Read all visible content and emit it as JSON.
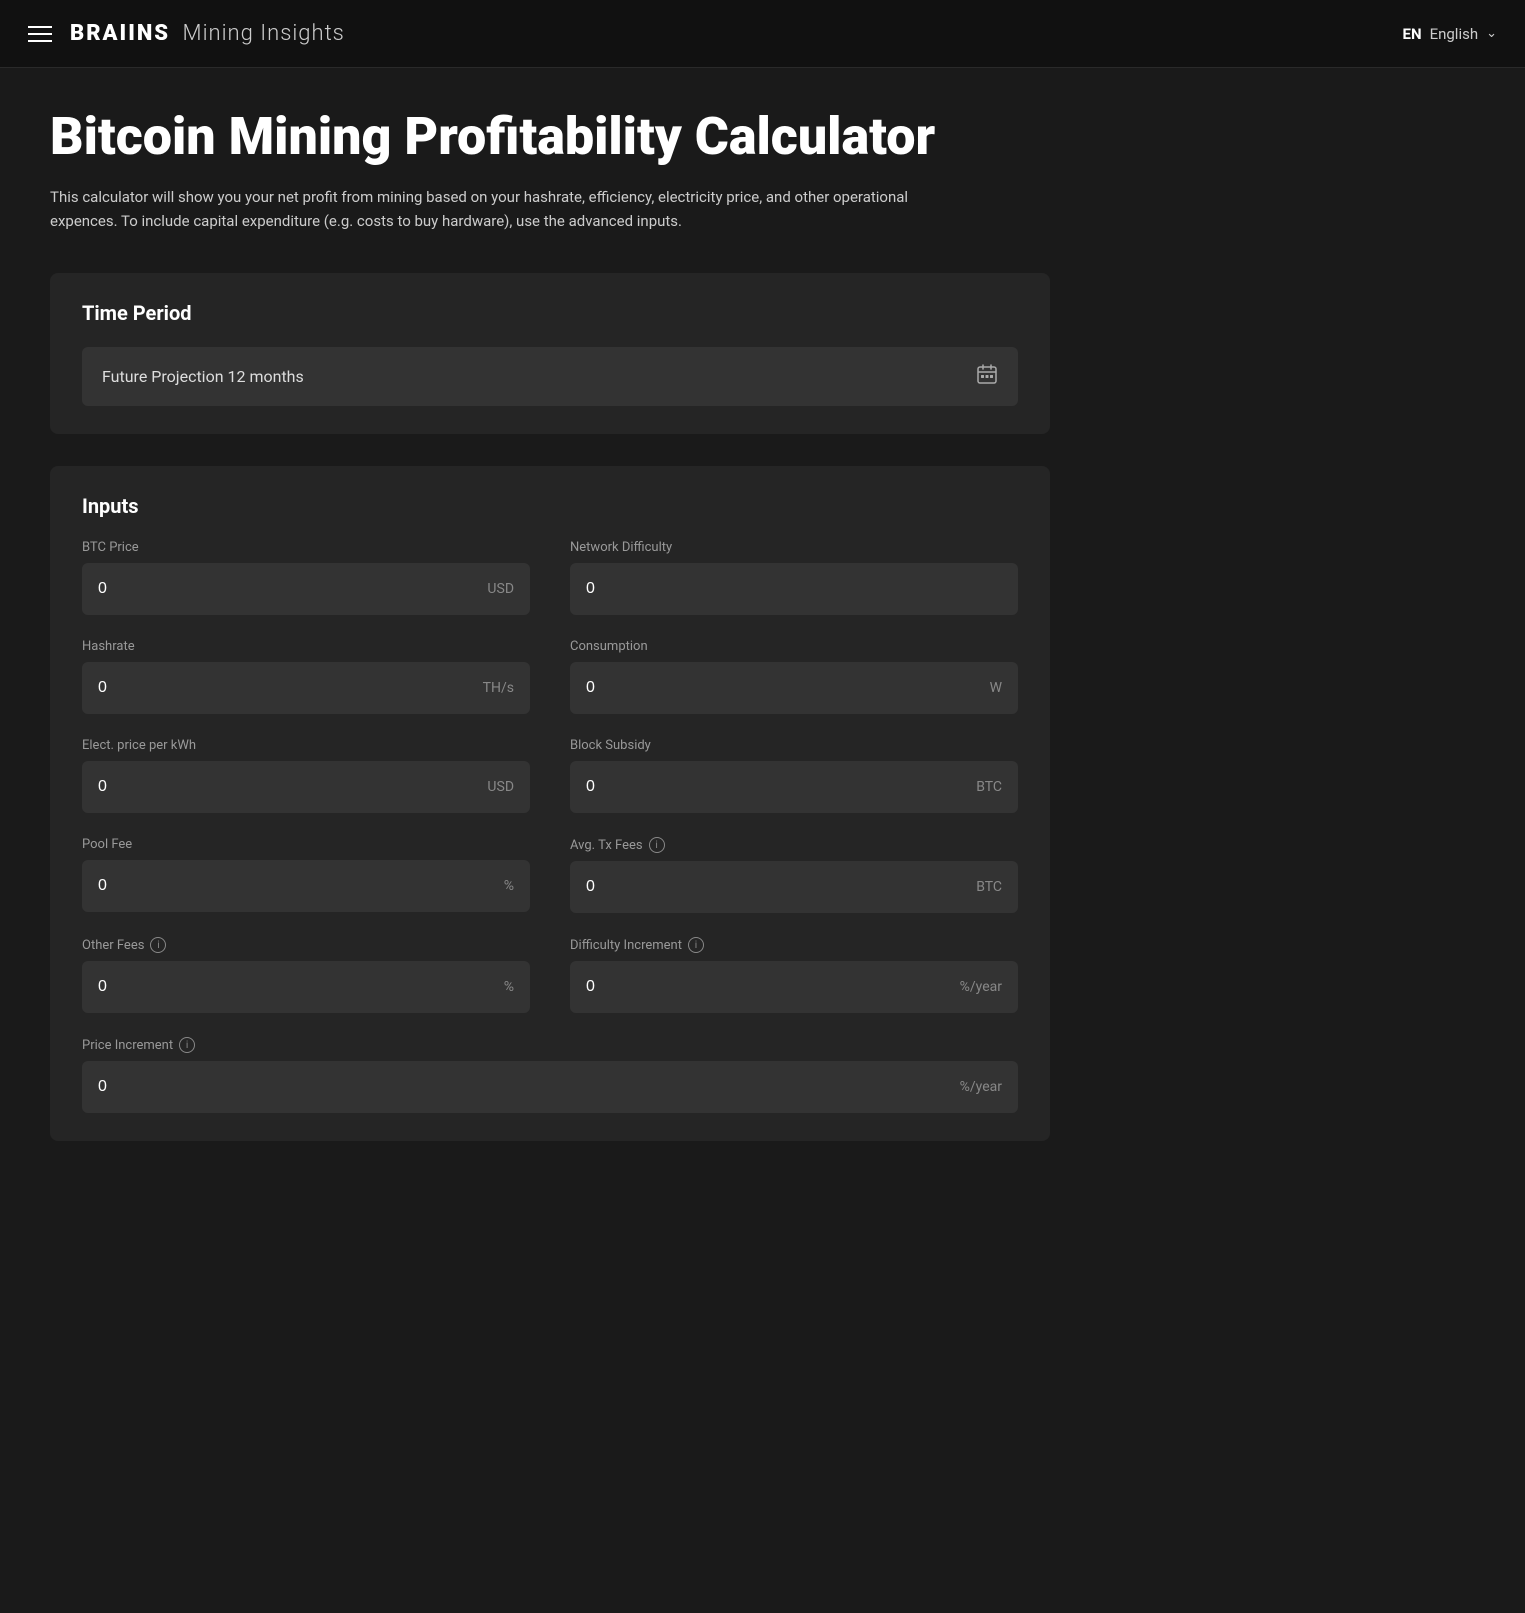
{
  "navbar": {
    "brand": "BRAIINS",
    "subtitle": "Mining Insights",
    "lang_code": "EN",
    "lang_name": "English"
  },
  "page": {
    "title": "Bitcoin Mining Profitability Calculator",
    "description": "This calculator will show you your net profit from mining based on your hashrate, efficiency, electricity price, and other operational expences. To include capital expenditure (e.g. costs to buy hardware), use the advanced inputs."
  },
  "time_period": {
    "section_title": "Time Period",
    "selected_label": "Future Projection 12 months"
  },
  "inputs": {
    "section_title": "Inputs",
    "fields": [
      {
        "id": "btc-price",
        "label": "BTC Price",
        "value": "0",
        "unit": "USD",
        "info": false,
        "full_width": false
      },
      {
        "id": "network-difficulty",
        "label": "Network Difficulty",
        "value": "0",
        "unit": "",
        "info": false,
        "full_width": false
      },
      {
        "id": "hashrate",
        "label": "Hashrate",
        "value": "0",
        "unit": "TH/s",
        "info": false,
        "full_width": false
      },
      {
        "id": "consumption",
        "label": "Consumption",
        "value": "0",
        "unit": "W",
        "info": false,
        "full_width": false
      },
      {
        "id": "elec-price",
        "label": "Elect. price per kWh",
        "value": "0",
        "unit": "USD",
        "info": false,
        "full_width": false
      },
      {
        "id": "block-subsidy",
        "label": "Block Subsidy",
        "value": "0",
        "unit": "BTC",
        "info": false,
        "full_width": false
      },
      {
        "id": "pool-fee",
        "label": "Pool Fee",
        "value": "0",
        "unit": "%",
        "info": false,
        "full_width": false
      },
      {
        "id": "avg-tx-fees",
        "label": "Avg. Tx Fees",
        "value": "0",
        "unit": "BTC",
        "info": true,
        "full_width": false
      },
      {
        "id": "other-fees",
        "label": "Other Fees",
        "value": "0",
        "unit": "%",
        "info": true,
        "full_width": false
      },
      {
        "id": "difficulty-increment",
        "label": "Difficulty Increment",
        "value": "0",
        "unit": "%/year",
        "info": true,
        "full_width": false
      },
      {
        "id": "price-increment",
        "label": "Price Increment",
        "value": "0",
        "unit": "%/year",
        "info": true,
        "full_width": true
      }
    ]
  }
}
